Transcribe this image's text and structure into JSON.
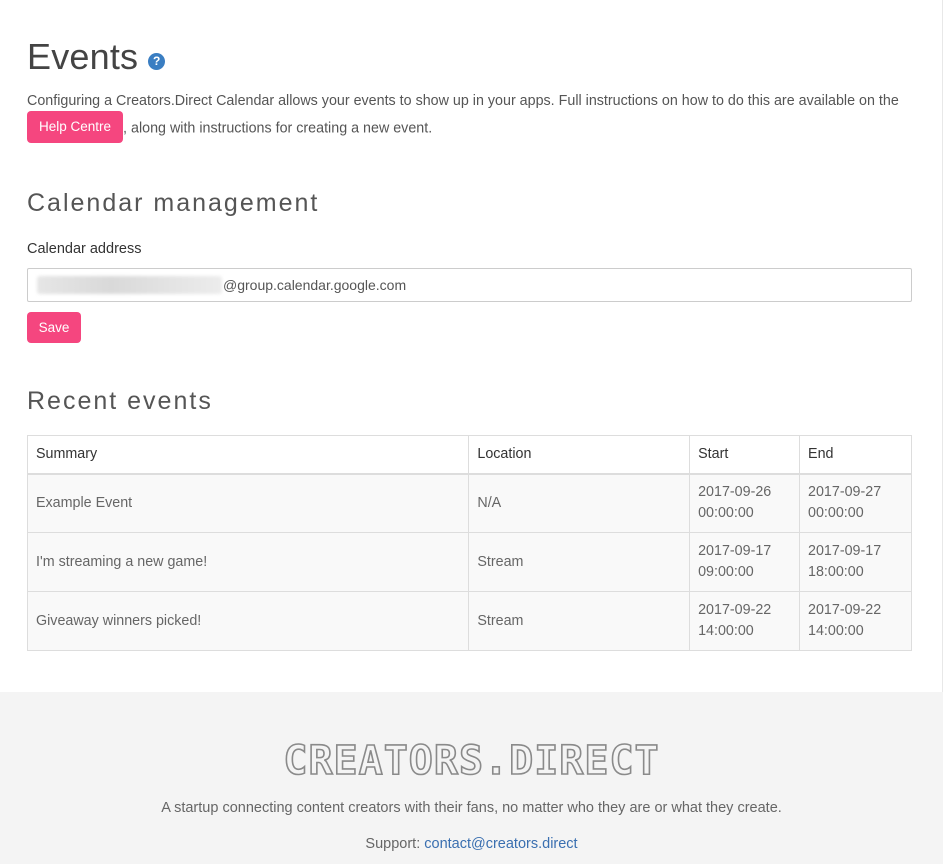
{
  "header": {
    "title": "Events",
    "help_icon": "question-circle-icon",
    "intro_before": "Configuring a Creators.Direct Calendar allows your events to show up in your apps. Full instructions on how to do this are available on the",
    "help_button": "Help Centre",
    "intro_after": ", along with instructions for creating a new event."
  },
  "calendar": {
    "section_title": "Calendar management",
    "field_label": "Calendar address",
    "address_value_visible": "@group.calendar.google.com",
    "save_label": "Save"
  },
  "events": {
    "section_title": "Recent events",
    "columns": [
      "Summary",
      "Location",
      "Start",
      "End"
    ],
    "rows": [
      {
        "summary": "Example Event",
        "location": "N/A",
        "start_date": "2017-09-26",
        "start_time": "00:00:00",
        "end_date": "2017-09-27",
        "end_time": "00:00:00"
      },
      {
        "summary": "I'm streaming a new game!",
        "location": "Stream",
        "start_date": "2017-09-17",
        "start_time": "09:00:00",
        "end_date": "2017-09-17",
        "end_time": "18:00:00"
      },
      {
        "summary": "Giveaway winners picked!",
        "location": "Stream",
        "start_date": "2017-09-22",
        "start_time": "14:00:00",
        "end_date": "2017-09-22",
        "end_time": "14:00:00"
      }
    ]
  },
  "footer": {
    "logo": "CREATORS.DIRECT",
    "tagline": "A startup connecting content creators with their fans, no matter who they are or what they create.",
    "support_label": "Support: ",
    "support_email": "contact@creators.direct"
  },
  "colors": {
    "accent": "#f5467f",
    "help_icon": "#3a7ec2",
    "link": "#3a6fb0",
    "footer_bg": "#f4f4f4"
  }
}
